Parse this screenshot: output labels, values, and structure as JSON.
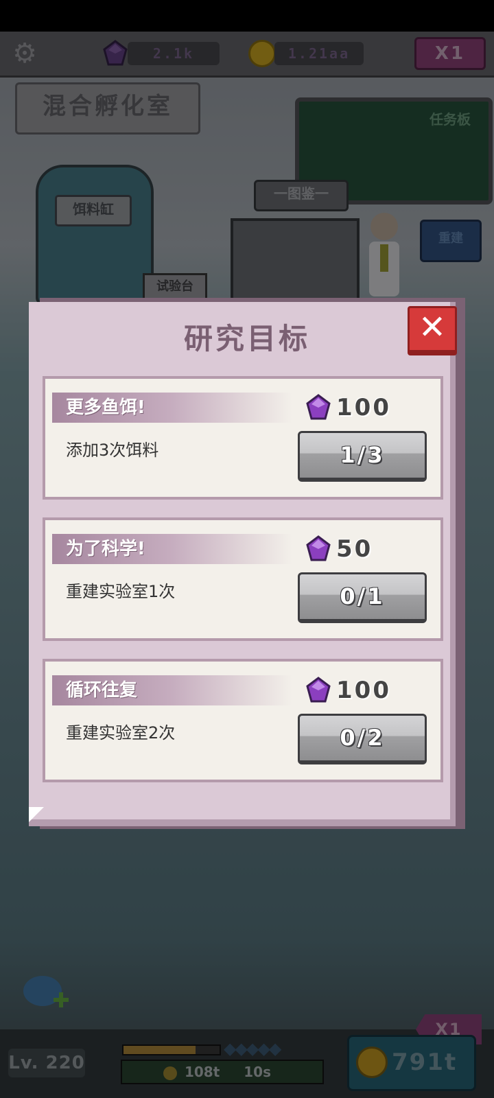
{
  "hud": {
    "gems": "2.1k",
    "coins": "1.21aa",
    "speed": "X1"
  },
  "scene": {
    "room_sign": "混合孵化室",
    "task_board": "任务板",
    "bait_tank": "饵料缸",
    "guide": "一图鉴一",
    "bench": "试验台",
    "rebuild": "重建"
  },
  "modal": {
    "title": "研究目标",
    "close_icon": "close-icon",
    "goals": [
      {
        "title": "更多鱼饵!",
        "desc": "添加3次饵料",
        "reward": "100",
        "progress": "1/3"
      },
      {
        "title": "为了科学!",
        "desc": "重建实验室1次",
        "reward": "50",
        "progress": "0/1"
      },
      {
        "title": "循环往复",
        "desc": "重建实验室2次",
        "reward": "100",
        "progress": "0/2"
      }
    ]
  },
  "bottom": {
    "level": "Lv. 220",
    "xp_fraction": 0.75,
    "coin_rate": "108t",
    "timer": "10s",
    "gold_total": "791t",
    "speed_flag": "X1"
  },
  "colors": {
    "modal_bg": "#dbc9d6",
    "card_bg": "#f3f0ea",
    "close_red": "#d63a3a",
    "gem_purple": "#8b3fbf"
  }
}
